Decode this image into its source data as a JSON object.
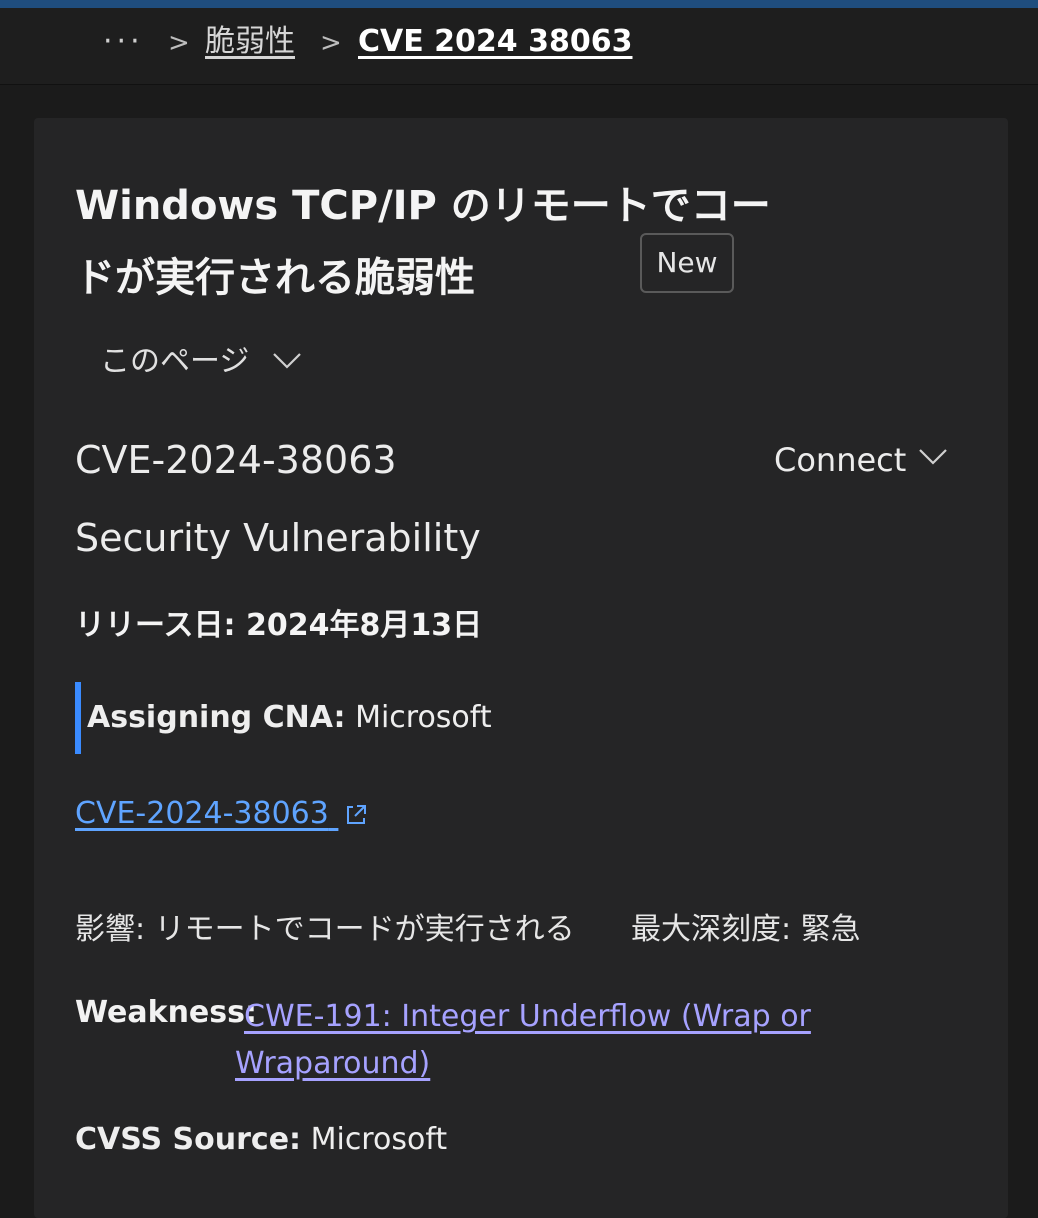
{
  "breadcrumb": {
    "ellipsis": "···",
    "separator": ">",
    "parent": "脆弱性",
    "current": "CVE 2024 38063"
  },
  "header": {
    "title": "Windows TCP/IP のリモートでコードが実行される脆弱性",
    "badge": "New"
  },
  "on_this_page": {
    "label": "このページ"
  },
  "cve": {
    "id": "CVE-2024-38063",
    "connect_label": "Connect",
    "subtitle": "Security Vulnerability",
    "release_label": "リリース日:",
    "release_date": "2024年8月13日",
    "cna_label": "Assigning CNA:",
    "cna_value": "Microsoft",
    "link_text": "CVE-2024-38063",
    "impact_label": "影響:",
    "impact_value": "リモートでコードが実行される",
    "severity_label": "最大深刻度:",
    "severity_value": "緊急",
    "weakness_label": "Weakness:",
    "weakness_value": "CWE-191: Integer Underflow (Wrap or Wraparound)",
    "cvss_source_label": "CVSS Source:",
    "cvss_source_value": "Microsoft"
  },
  "colors": {
    "accent_bar": "#3a8bff",
    "link": "#5fa4ff",
    "weakness_link": "#a6a2ff",
    "background": "#1b1b1b",
    "card": "#252526"
  },
  "icons": {
    "breadcrumb_separator": "chevron-right-icon",
    "dropdown": "chevron-down-icon",
    "external_link": "external-link-icon"
  }
}
